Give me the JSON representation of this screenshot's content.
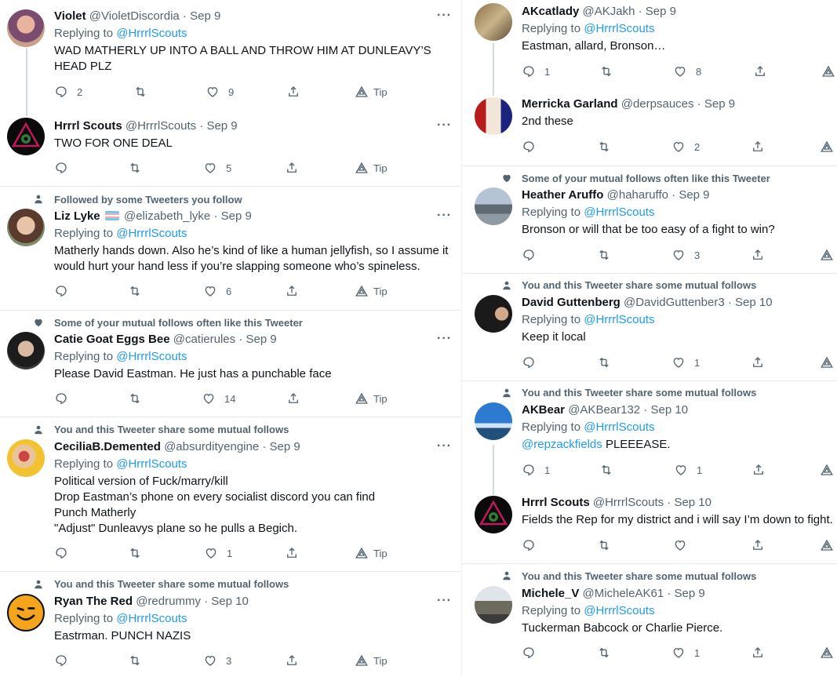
{
  "left": {
    "tweets": [
      {
        "name": "Violet",
        "handle": "@VioletDiscordia",
        "date": "Sep 9",
        "replying": "Replying to",
        "replying_to": "@HrrrlScouts",
        "lines": [
          "WAD MATHERLY UP INTO A BALL AND THROW HIM AT DUNLEAVY’S",
          "HEAD PLZ"
        ],
        "reply": "2",
        "retweet": "",
        "like": "9",
        "tip": "Tip"
      },
      {
        "name": "Hrrrl Scouts",
        "handle": "@HrrrlScouts",
        "date": "Sep 9",
        "lines": [
          "TWO FOR ONE DEAL"
        ],
        "reply": "",
        "retweet": "",
        "like": "5",
        "tip": "Tip"
      },
      {
        "social": "Followed by some Tweeters you follow",
        "name": "Liz Lyke",
        "handle": "@elizabeth_lyke",
        "date": "Sep 9",
        "replying": "Replying to",
        "replying_to": "@HrrrlScouts",
        "lines": [
          "Matherly hands down. Also he’s kind of like a human jellyfish, so I assume it",
          "would hurt your hand less if you’re slapping someone who’s spineless."
        ],
        "reply": "",
        "retweet": "",
        "like": "6",
        "tip": "Tip"
      },
      {
        "social": "Some of your mutual follows often like this Tweeter",
        "name": "Catie Goat Eggs Bee",
        "handle": "@catierules",
        "date": "Sep 9",
        "replying": "Replying to",
        "replying_to": "@HrrrlScouts",
        "lines": [
          "Please David Eastman. He just has a punchable face"
        ],
        "reply": "",
        "retweet": "",
        "like": "14",
        "tip": "Tip"
      },
      {
        "social": "You and this Tweeter share some mutual follows",
        "name": "CeciliaB.Demented",
        "handle": "@absurdityengine",
        "date": "Sep 9",
        "replying": "Replying to",
        "replying_to": "@HrrrlScouts",
        "lines": [
          "Political version of Fuck/marry/kill",
          "Drop Eastman’s phone on every socialist discord you can find",
          "Punch Matherly",
          "\"Adjust\" Dunleavys plane so he pulls a Begich."
        ],
        "reply": "",
        "retweet": "",
        "like": "1",
        "tip": "Tip"
      },
      {
        "social": "You and this Tweeter share some mutual follows",
        "name": "Ryan The Red",
        "handle": "@redrummy",
        "date": "Sep 10",
        "replying": "Replying to",
        "replying_to": "@HrrrlScouts",
        "lines": [
          "Eastrman. PUNCH NAZIS"
        ],
        "reply": "",
        "retweet": "",
        "like": "3",
        "tip": "Tip"
      }
    ]
  },
  "right": {
    "tweets": [
      {
        "name": "AKcatlady",
        "handle": "@AKJakh",
        "date": "Sep 9",
        "replying": "Replying to",
        "replying_to": "@HrrrlScouts",
        "lines": [
          "Eastman, allard, Bronson…"
        ],
        "reply": "1",
        "retweet": "",
        "like": "8"
      },
      {
        "name": "Merricka Garland",
        "handle": "@derpsauces",
        "date": "Sep 9",
        "lines": [
          "2nd these"
        ],
        "reply": "",
        "retweet": "",
        "like": "2"
      },
      {
        "social": "Some of your mutual follows often like this Tweeter",
        "name": "Heather Aruffo",
        "handle": "@haharuffo",
        "date": "Sep 9",
        "replying": "Replying to",
        "replying_to": "@HrrrlScouts",
        "lines": [
          "Bronson or will that be too easy of a fight to win?"
        ],
        "reply": "",
        "retweet": "",
        "like": "3"
      },
      {
        "social": "You and this Tweeter share some mutual follows",
        "name": "David Guttenberg",
        "handle": "@DavidGuttenber3",
        "date": "Sep 10",
        "replying": "Replying to",
        "replying_to": "@HrrrlScouts",
        "lines": [
          "Keep it local"
        ],
        "reply": "",
        "retweet": "",
        "like": "1"
      },
      {
        "social": "You and this Tweeter share some mutual follows",
        "name": "AKBear",
        "handle": "@AKBear132",
        "date": "Sep 10",
        "replying": "Replying to",
        "replying_to": "@HrrrlScouts",
        "mention": "@repzackfields",
        "lines": [
          "PLEEEASE."
        ],
        "reply": "1",
        "retweet": "",
        "like": "1"
      },
      {
        "name": "Hrrrl Scouts",
        "handle": "@HrrrlScouts",
        "date": "Sep 10",
        "lines": [
          "Fields the Rep for my district and i will say I’m down to fight."
        ],
        "reply": "",
        "retweet": "",
        "like": ""
      },
      {
        "social": "You and this Tweeter share some mutual follows",
        "name": "Michele_V",
        "handle": "@MicheleAK61",
        "date": "Sep 9",
        "replying": "Replying to",
        "replying_to": "@HrrrlScouts",
        "lines": [
          "Tuckerman Babcock or Charlie Pierce."
        ],
        "reply": "",
        "retweet": "",
        "like": "1"
      }
    ]
  },
  "colors": {
    "link": "#1d9bf0",
    "muted": "#536471",
    "divider": "#e7ebec",
    "thread": "#cfd9de"
  }
}
